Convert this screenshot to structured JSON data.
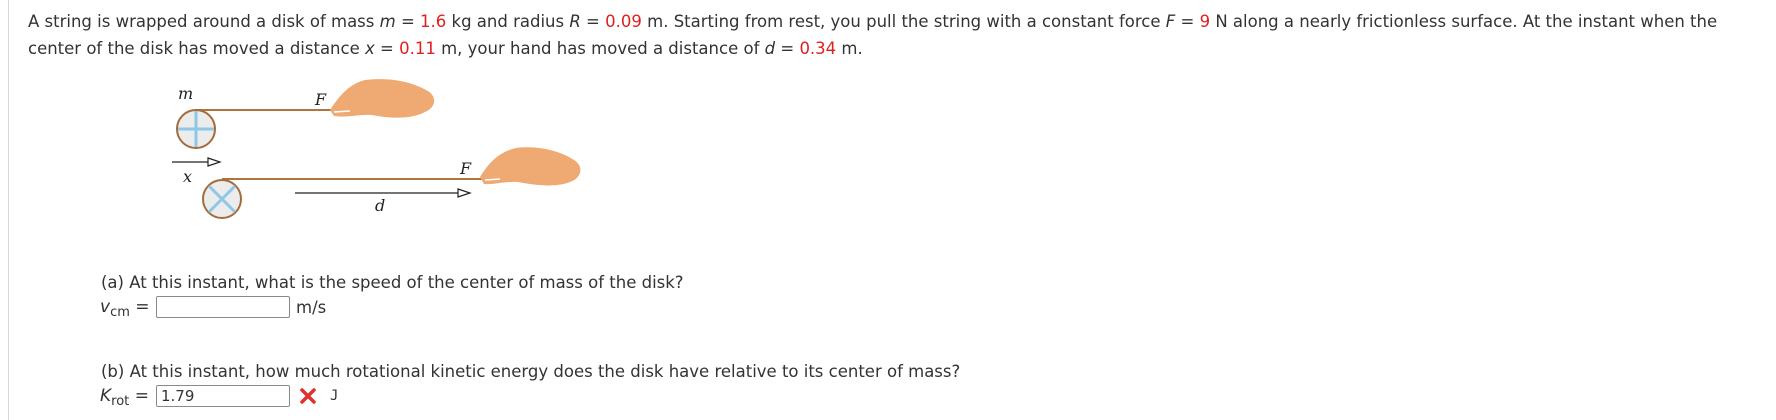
{
  "problem": {
    "p1": "A string is wrapped around a disk of mass ",
    "m_sym": "m",
    "eq1": " = ",
    "m_val": "1.6",
    "p2": " kg and radius ",
    "R_sym": "R",
    "eq2": " = ",
    "R_val": "0.09",
    "p3": " m. Starting from rest, you pull the string with a constant force ",
    "F_sym": "F",
    "eq3": " = ",
    "F_val": "9",
    "p4": " N along a nearly frictionless surface. At the instant when the center of the disk has moved a distance ",
    "x_sym": "x",
    "eq4": " = ",
    "x_val": "0.11",
    "p5": " m, your hand has moved a distance of ",
    "d_sym": "d",
    "eq5": " = ",
    "d_val": "0.34",
    "p6": " m."
  },
  "figure": {
    "label_m": "m",
    "label_F_top": "F",
    "label_x": "x",
    "label_F_bottom": "F",
    "label_d": "d",
    "colors": {
      "string": "#b0743e",
      "hand": "#eeaa72",
      "disk_fill": "#ececec",
      "disk_rim": "#a66b3a",
      "spokes": "#8ec7e8"
    }
  },
  "part_a": {
    "question": "(a) At this instant, what is the speed of the center of mass of the disk?",
    "label_main": "v",
    "label_sub": "cm",
    "equals": "=",
    "value": "",
    "unit": "m/s"
  },
  "part_b": {
    "question": "(b) At this instant, how much rotational kinetic energy does the disk have relative to its center of mass?",
    "label_main": "K",
    "label_sub": "rot",
    "equals": "=",
    "value": "1.79",
    "status_icon": "incorrect-x-icon",
    "unit": "J",
    "status_color": "#e03030"
  }
}
